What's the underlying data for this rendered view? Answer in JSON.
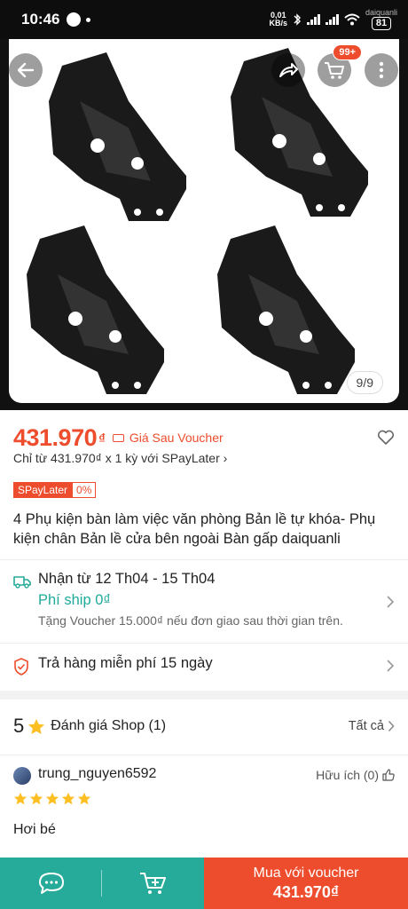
{
  "status_bar": {
    "time": "10:46",
    "net_speed_value": "0,01",
    "net_speed_unit": "KB/s",
    "carrier_label": "daiquanli",
    "battery": "81"
  },
  "gallery": {
    "counter": "9/9",
    "cart_badge": "99+"
  },
  "price": {
    "value": "431.970",
    "currency": "₫",
    "voucher_label": "Giá Sau Voucher"
  },
  "installment": {
    "text": "Chỉ từ 431.970₫ x 1 kỳ với SPayLater",
    "arrow": "›"
  },
  "spaylater": {
    "name": "SPayLater",
    "rate": "0%"
  },
  "product": {
    "title": "4 Phụ kiện bàn làm việc văn phòng Bản lề tự khóa- Phụ kiện chân Bản lề cửa bên ngoài Bàn gấp daiquanli"
  },
  "shipping": {
    "date": "Nhận từ 12 Th04 - 15 Th04",
    "fee": "Phí ship 0₫",
    "voucher": "Tặng Voucher 15.000₫ nếu đơn giao sau thời gian trên."
  },
  "returns": {
    "text": "Trả hàng miễn phí 15 ngày"
  },
  "rating": {
    "score": "5",
    "label": "Đánh giá Shop (1)",
    "see_all": "Tất cả"
  },
  "review": {
    "username": "trung_nguyen6592",
    "helpful": "Hữu ích (0)",
    "stars": 5,
    "comment": "Hơi bé"
  },
  "bottom_bar": {
    "buy_label": "Mua với voucher",
    "buy_price": "431.970₫"
  },
  "colors": {
    "accent": "#ee4d2d",
    "teal": "#26aa99",
    "star": "#fbbf24"
  }
}
